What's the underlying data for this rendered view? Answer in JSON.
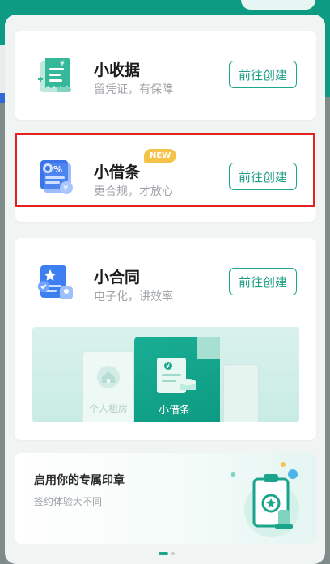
{
  "cards": [
    {
      "title": "小收据",
      "subtitle": "留凭证，有保障",
      "button": "前往创建",
      "icon": "receipt-icon"
    },
    {
      "title": "小借条",
      "subtitle": "更合规，才放心",
      "button": "前往创建",
      "icon": "loan-note-icon",
      "badge": "NEW"
    },
    {
      "title": "小合同",
      "subtitle": "电子化，讲效率",
      "button": "前往创建",
      "icon": "contract-icon"
    }
  ],
  "preview": {
    "ghost_label": "个人租房",
    "main_label": "小借条"
  },
  "seal_banner": {
    "title": "启用你的专属印章",
    "subtitle": "签约体验大不同",
    "icon": "seal-clipboard-icon"
  },
  "pager": {
    "total": 2,
    "active": 1
  },
  "colors": {
    "accent": "#1d9d85",
    "badge": "#f6c34a",
    "highlight": "#e42121"
  }
}
